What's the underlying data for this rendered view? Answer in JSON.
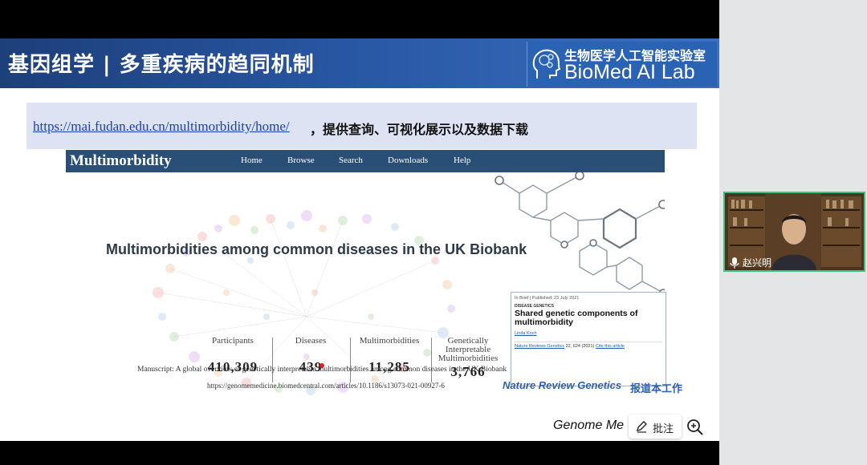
{
  "slide": {
    "title": "基因组学 | 多重疾病的趋同机制",
    "lab_name_cn": "生物医学人工智能实验室",
    "lab_name_en": "BioMed AI Lab",
    "url": "https://mai.fudan.edu.cn/multimorbidity/home/",
    "url_suffix": "，提供查询、可视化展示以及数据下载",
    "site": {
      "logo": "Multimorbidity",
      "nav": [
        "Home",
        "Browse",
        "Search",
        "Downloads",
        "Help"
      ]
    },
    "hero_title": "Multimorbidities among common diseases in the UK Biobank",
    "stats": [
      {
        "label": "Participants",
        "value": "410,309"
      },
      {
        "label": "Diseases",
        "value": "439"
      },
      {
        "label": "Multimorbidities",
        "value": "11,285"
      },
      {
        "label": "Genetically Interpretable Multimorbidities",
        "value": "3,766"
      }
    ],
    "paper": {
      "header": "In Brief | Published: 23 July 2021",
      "section": "DISEASE GENETICS",
      "title": "Shared genetic components of multimorbidity",
      "author": "Linda Koch",
      "citation_journal": "Nature Reviews Genetics",
      "citation_rest": "22, 624 (2021)",
      "cite_link": "Cite this article"
    },
    "manuscript": "Manuscript: A global overview of genetically interpretable multimorbidities among common diseases in the UK Biobank",
    "doi": "https://genomemedicine.biomedcentral.com/articles/10.1186/s13073-021-00927-6",
    "nrg": "Nature Review Genetics",
    "nrg_suffix": "报道本工作",
    "footer_journal": "Genome Me"
  },
  "toolbar": {
    "annotate_label": "批注"
  },
  "video": {
    "speaker": "赵兴明"
  },
  "colors": {
    "title_bar": "#2a5aa8",
    "url_banner": "#dde3f3",
    "site_nav": "#2a4f77",
    "link": "#1a3dbb",
    "nrg_blue": "#2c5fb8",
    "video_border": "#3ec07c"
  }
}
